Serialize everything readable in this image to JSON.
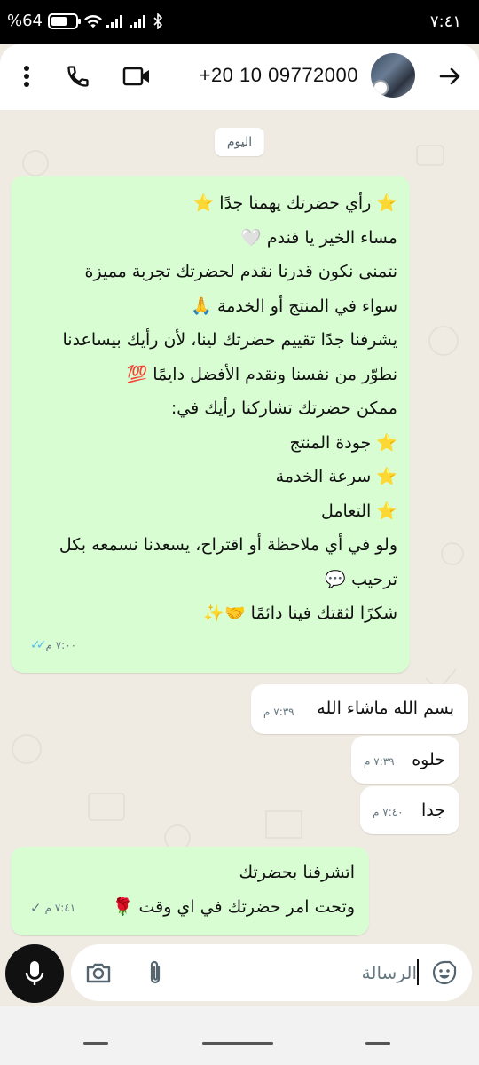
{
  "status_bar": {
    "battery_label": "%64",
    "battery_level": 0.64,
    "time": "٧:٤١"
  },
  "header": {
    "contact_name": "+20 10 09772000",
    "icons": [
      "more-vert-icon",
      "phone-icon",
      "video-icon",
      "back-arrow-icon"
    ]
  },
  "chat": {
    "date_chip": "اليوم",
    "messages": [
      {
        "direction": "out",
        "lines": [
          "⭐ رأي حضرتك يهمنا جدًا ⭐",
          "مساء الخير يا فندم 🤍",
          "نتمنى نكون قدرنا نقدم لحضرتك تجربة مميزة",
          "سواء في المنتج أو الخدمة 🙏",
          "يشرفنا جدًا تقييم حضرتك لينا، لأن رأيك بيساعدنا",
          "نطوّر من نفسنا ونقدم الأفضل دايمًا 💯",
          "ممكن حضرتك تشاركنا رأيك في:",
          "⭐ جودة المنتج",
          "⭐ سرعة الخدمة",
          "⭐ التعامل",
          "ولو في أي ملاحظة أو اقتراح، يسعدنا نسمعه بكل",
          "ترحيب 💬",
          "شكرًا لثقتك فينا دائمًا 🤝✨"
        ],
        "time": "٧:٠٠ م",
        "status": "read"
      },
      {
        "direction": "in",
        "lines": [
          "بسم الله ماشاء الله"
        ],
        "time": "٧:٣٩ م"
      },
      {
        "direction": "in",
        "lines": [
          "حلوه"
        ],
        "time": "٧:٣٩ م"
      },
      {
        "direction": "in",
        "lines": [
          "جدا"
        ],
        "time": "٧:٤٠ م"
      },
      {
        "direction": "out",
        "lines": [
          "اتشرفنا بحضرتك",
          "وتحت امر حضرتك في اي وقت 🌹"
        ],
        "time": "٧:٤١ م",
        "status": "sent"
      }
    ]
  },
  "input": {
    "placeholder": "الرسالة"
  }
}
